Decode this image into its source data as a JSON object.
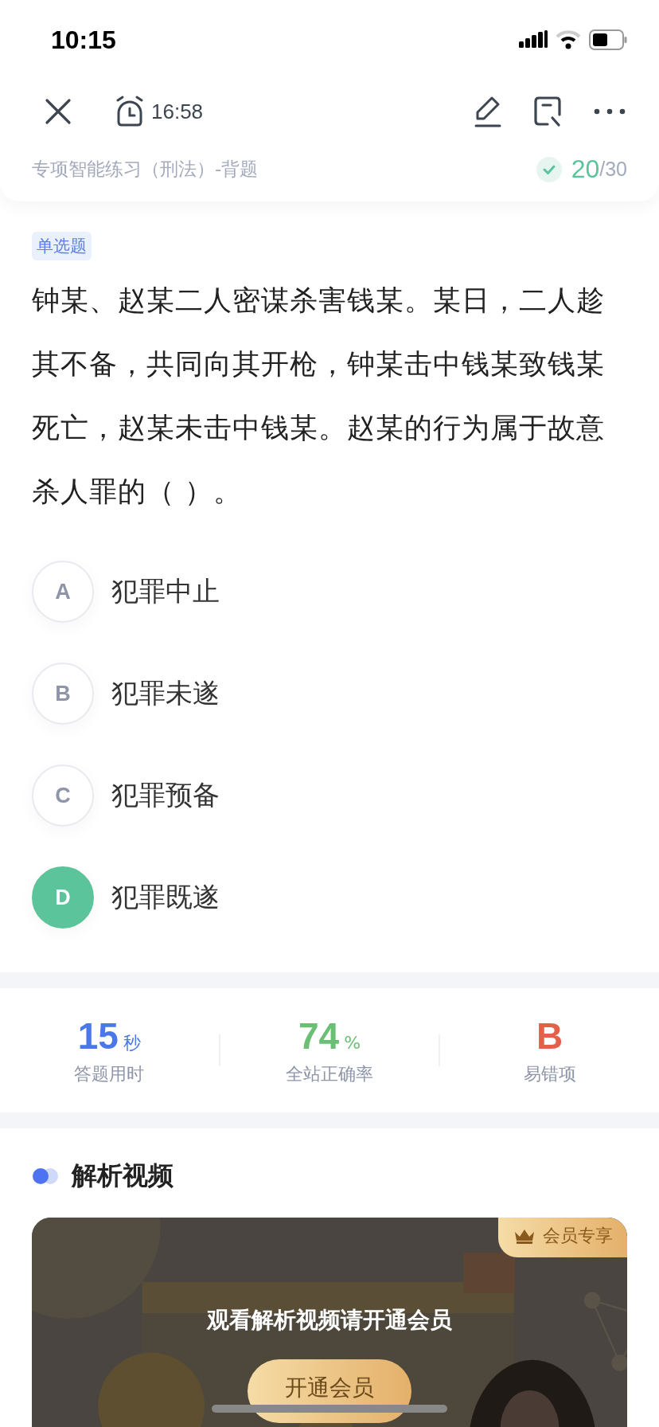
{
  "status_bar": {
    "time": "10:15"
  },
  "toolbar": {
    "timer": "16:58"
  },
  "header": {
    "title": "专项智能练习（刑法）-背题",
    "progress_done": "20",
    "progress_total": "/30"
  },
  "question": {
    "type_tag": "单选题",
    "text": "钟某、赵某二人密谋杀害钱某。某日，二人趁其不备，共同向其开枪，钟某击中钱某致钱某死亡，赵某未击中钱某。赵某的行为属于故意杀人罪的（ ）。"
  },
  "options": [
    {
      "letter": "A",
      "text": "犯罪中止",
      "selected": false
    },
    {
      "letter": "B",
      "text": "犯罪未遂",
      "selected": false
    },
    {
      "letter": "C",
      "text": "犯罪预备",
      "selected": false
    },
    {
      "letter": "D",
      "text": "犯罪既遂",
      "selected": true
    }
  ],
  "stats": [
    {
      "value": "15",
      "unit": "秒",
      "label": "答题用时",
      "color": "#4a78e8"
    },
    {
      "value": "74",
      "unit": "%",
      "label": "全站正确率",
      "color": "#6bbf74"
    },
    {
      "value": "B",
      "label": "易错项",
      "color": "#e5604a"
    }
  ],
  "video_section": {
    "title": "解析视频",
    "badge": "会员专享",
    "message": "观看解析视频请开通会员",
    "button": "开通会员"
  }
}
